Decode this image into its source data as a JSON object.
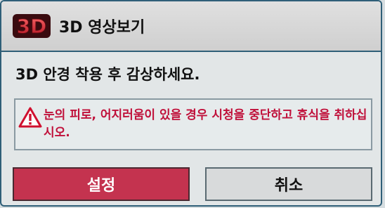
{
  "header": {
    "logo_text": "3D",
    "title": "3D 영상보기"
  },
  "message": "3D 안경 착용 후 감상하세요.",
  "warning": {
    "icon": "warning-triangle-icon",
    "text": "눈의 피로, 어지러움이 있을 경우 시청을 중단하고 휴식을 취하십시오."
  },
  "buttons": {
    "ok_label": "설정",
    "cancel_label": "취소"
  },
  "colors": {
    "accent_red": "#c4334f",
    "warning_red": "#c0103a",
    "border_blue": "#2f5f78"
  }
}
